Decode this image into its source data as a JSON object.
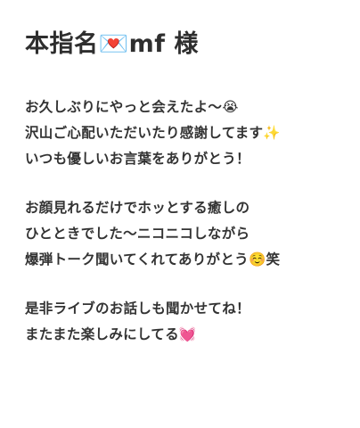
{
  "title": "本指名💌mf 様",
  "paragraphs": [
    {
      "lines": [
        "お久しぶりにやっと会えたよ〜😭",
        "沢山ご心配いただいたり感謝してます✨",
        "いつも優しいお言葉をありがとう！"
      ]
    },
    {
      "lines": [
        "お顔見れるだけでホッとする癒しの",
        "ひとときでした〜ニコニコしながら",
        "爆弾トーク聞いてくれてありがとう☺️笑"
      ]
    },
    {
      "lines": [
        "是非ライブのお話しも聞かせてね！",
        "またまた楽しみにしてる💓"
      ]
    }
  ]
}
